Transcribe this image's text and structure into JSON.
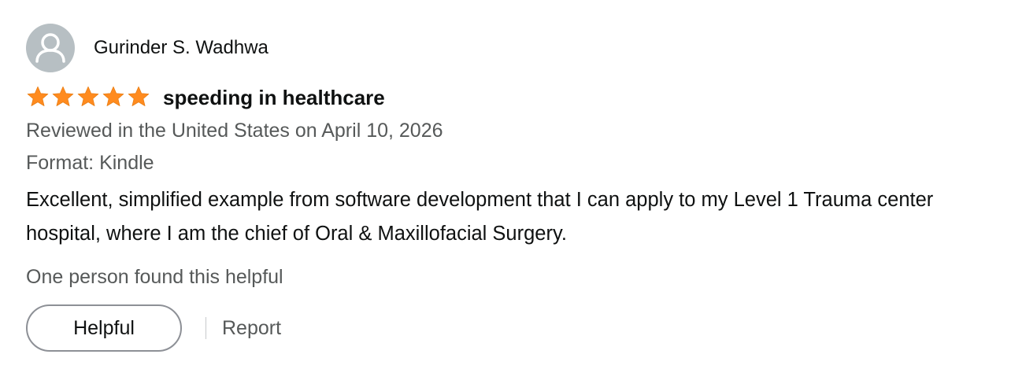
{
  "review": {
    "reviewer_name": "Gurinder S. Wadhwa",
    "avatar_icon": "person-icon",
    "rating": 5,
    "rating_max": 5,
    "star_color": "#ff8b1f",
    "title": "speeding in healthcare",
    "date_text": "Reviewed in the United States on April 10, 2026",
    "format_text": "Format: Kindle",
    "body": "Excellent, simplified example from software development that I can apply to my Level 1 Trauma center hospital, where I am the chief of Oral & Maxillofacial Surgery.",
    "helpful_count_text": "One person found this helpful"
  },
  "actions": {
    "helpful_label": "Helpful",
    "report_label": "Report"
  }
}
